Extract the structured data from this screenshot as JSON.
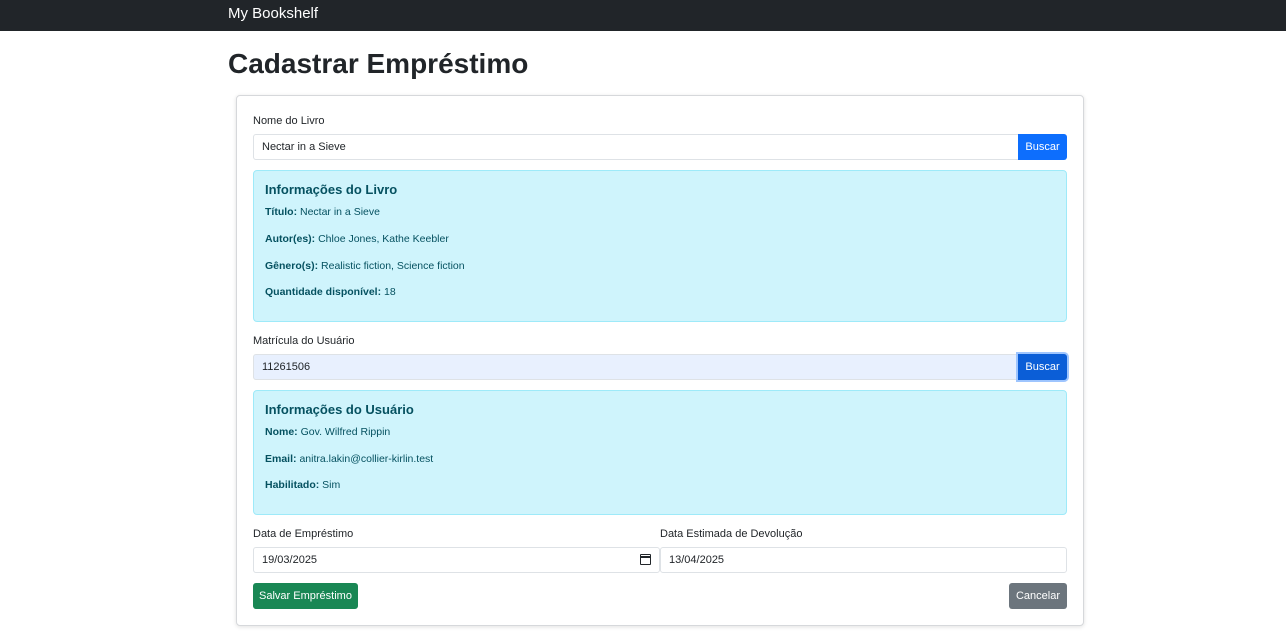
{
  "navbar": {
    "brand": "My Bookshelf"
  },
  "page": {
    "title": "Cadastrar Empréstimo"
  },
  "book": {
    "label": "Nome do Livro",
    "value": "Nectar in a Sieve",
    "search_label": "Buscar",
    "info": {
      "title": "Informações do Livro",
      "fields": [
        {
          "key": "Título:",
          "value": "Nectar in a Sieve"
        },
        {
          "key": "Autor(es):",
          "value": "Chloe Jones, Kathe Keebler"
        },
        {
          "key": "Gênero(s):",
          "value": "Realistic fiction, Science fiction"
        },
        {
          "key": "Quantidade disponível:",
          "value": "18"
        }
      ]
    }
  },
  "user": {
    "label": "Matrícula do Usuário",
    "value": "11261506",
    "search_label": "Buscar",
    "info": {
      "title": "Informações do Usuário",
      "fields": [
        {
          "key": "Nome:",
          "value": "Gov. Wilfred Rippin"
        },
        {
          "key": "Email:",
          "value": "anitra.lakin@collier-kirlin.test"
        },
        {
          "key": "Habilitado:",
          "value": "Sim"
        }
      ]
    }
  },
  "dates": {
    "loan_label": "Data de Empréstimo",
    "loan_value": "19/03/2025",
    "return_label": "Data Estimada de Devolução",
    "return_value": "13/04/2025"
  },
  "actions": {
    "save_label": "Salvar Empréstimo",
    "cancel_label": "Cancelar"
  },
  "colors": {
    "navbar": "#212529",
    "primary": "#0d6efd",
    "success": "#198754",
    "secondary": "#6c757d",
    "info_bg": "#cff4fc",
    "info_text": "#055160"
  }
}
